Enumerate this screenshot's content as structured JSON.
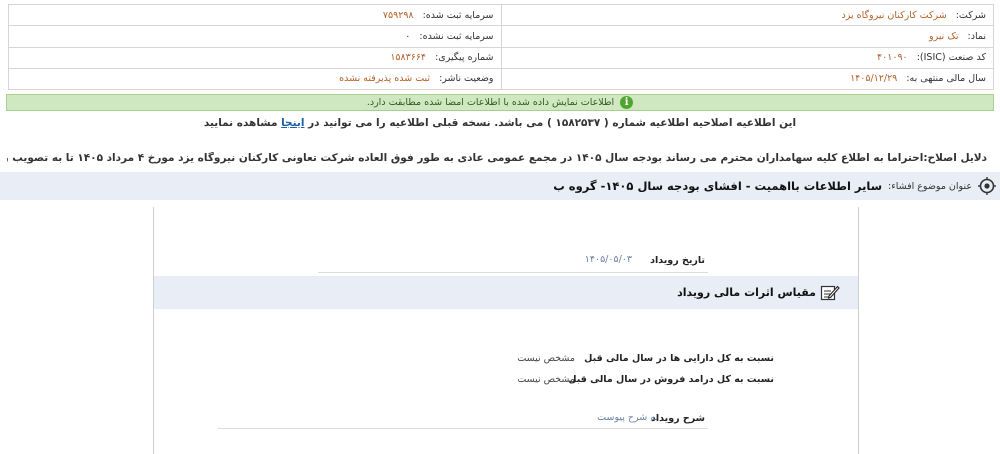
{
  "info": {
    "company_label": "شرکت:",
    "company_value": "شرکت کارکنان نیروگاه یزد",
    "registered_capital_label": "سرمایه ثبت شده:",
    "registered_capital_value": "۷۵۹۲۹۸",
    "symbol_label": "نماد:",
    "symbol_value": "تک نیرو",
    "unregistered_capital_label": "سرمایه ثبت نشده:",
    "unregistered_capital_value": "۰",
    "isic_label": "کد صنعت (ISIC):",
    "isic_value": "۴۰۱۰۹۰",
    "tracking_label": "شماره پیگیری:",
    "tracking_value": "۱۵۸۳۶۶۴",
    "fiscal_year_label": "سال مالی منتهی به:",
    "fiscal_year_value": "۱۴۰۵/۱۲/۲۹",
    "publisher_status_label": "وضعیت ناشر:",
    "publisher_status_value": "ثبت شده پذیرفته نشده"
  },
  "alert": {
    "text": "اطلاعات نمایش داده شده با اطلاعات امضا شده مطابقت دارد."
  },
  "amend": {
    "before": "این اطلاعیه اصلاحیه اطلاعیه شماره ( ۱۵۸۲۵۳۷ ) می باشد. نسخه قبلی اطلاعیه را می توانید در",
    "link": "اینجا",
    "after": "مشاهده نمایید"
  },
  "reasons": {
    "text": "دلایل اصلاح:احتراما به اطلاع کلیه سهامداران محترم می رساند بودجه سال ۱۴۰۵ در مجمع عمومی عادی به طور فوق العاده شرکت تعاونی کارکنان نیروگاه یزد مورخ ۴ مرداد ۱۴۰۵ تا به تصویب رسید که به پیوست افشا می گردد."
  },
  "subject": {
    "label": "عنوان موضوع افشاء:",
    "value": "سایر اطلاعات بااهمیت - افشای بودجه سال ۱۴۰۵- گروه ب"
  },
  "event": {
    "date_label": "تاریخ رویداد",
    "date_value": "۱۴۰۵/۰۵/۰۳",
    "section_title": "مقیاس اثرات مالی رویداد",
    "rows": [
      {
        "label": "نسبت به کل دارایی ها در سال مالی قبل",
        "value": "مشخص نیست"
      },
      {
        "label": "نسبت به کل درامد فروش در سال مالی قبل",
        "value": "مشخص نیست"
      }
    ],
    "desc_label": "شرح رویداد",
    "desc_value": "به شرح پیوست"
  },
  "colors": {
    "value_orange": "#b3622c",
    "alert_green_bg": "#cfe8c1",
    "link_blue": "#1c5fa8",
    "bar_blue_bg": "#e9eef6"
  }
}
